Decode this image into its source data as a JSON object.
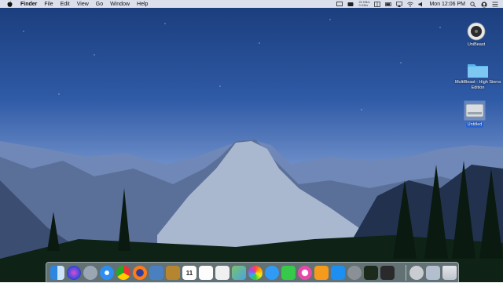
{
  "menubar": {
    "menus": [
      "Finder",
      "File",
      "Edit",
      "View",
      "Go",
      "Window",
      "Help"
    ],
    "clock": "Mon 12:06 PM",
    "netstat_up": "22 KB/s",
    "netstat_down": "0 KB/s"
  },
  "desktop_icons": {
    "unibeast": "UniBeast",
    "multibeast": "MultiBeast - High Sierra Edition",
    "untitled": "Untitled"
  },
  "dock": {
    "calendar_day": "11",
    "apps": [
      "finder-icon",
      "siri-icon",
      "launchpad-icon",
      "safari-icon",
      "chrome-icon",
      "firefox-icon",
      "preview-icon",
      "notes-icon",
      "calendar-icon",
      "reminders-icon",
      "textedit-icon",
      "maps-icon",
      "photos-icon",
      "messages-icon",
      "facetime-icon",
      "itunes-icon",
      "ibooks-icon",
      "app-store-icon",
      "system-preferences-icon",
      "activity-monitor-icon",
      "terminal-icon",
      "disk-utility-icon",
      "downloads-icon",
      "trash-icon"
    ]
  },
  "colors": {
    "selection": "#2a66d9",
    "menubar": "#ebeef5"
  }
}
